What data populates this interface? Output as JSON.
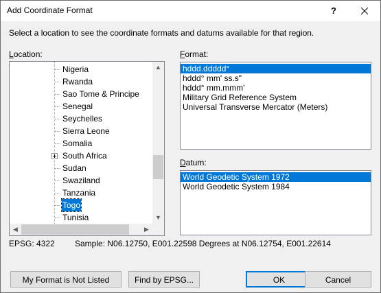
{
  "window": {
    "title": "Add Coordinate Format",
    "help_glyph": "?"
  },
  "instructions": "Select a location to see the coordinate formats and datums available for that region.",
  "location": {
    "label_accel": "L",
    "label_rest": "ocation:",
    "items": [
      {
        "label": "Nigeria"
      },
      {
        "label": "Rwanda"
      },
      {
        "label": "Sao Tome & Principe"
      },
      {
        "label": "Senegal"
      },
      {
        "label": "Seychelles"
      },
      {
        "label": "Sierra Leone"
      },
      {
        "label": "Somalia"
      },
      {
        "label": "South Africa",
        "expandable": true
      },
      {
        "label": "Sudan"
      },
      {
        "label": "Swaziland"
      },
      {
        "label": "Tanzania"
      },
      {
        "label": "Togo",
        "selected": true
      },
      {
        "label": "Tunisia"
      }
    ]
  },
  "format": {
    "label_accel": "F",
    "label_rest": "ormat:",
    "items": [
      {
        "label": "hddd.ddddd°",
        "selected": true
      },
      {
        "label": "hddd° mm' ss.s\""
      },
      {
        "label": "hddd° mm.mmm'"
      },
      {
        "label": "Military Grid Reference System"
      },
      {
        "label": "Universal Transverse Mercator (Meters)"
      }
    ]
  },
  "datum": {
    "label_accel": "D",
    "label_rest": "atum:",
    "items": [
      {
        "label": "World Geodetic System 1972",
        "selected": true
      },
      {
        "label": "World Geodetic System 1984"
      }
    ]
  },
  "epsg": "EPSG: 4322",
  "sample": "Sample: N06.12750, E001.22598 Degrees at N06.12754, E001.22614",
  "buttons": {
    "not_listed": "My Format is Not Listed",
    "find_epsg": "Find by EPSG...",
    "ok": "OK",
    "cancel": "Cancel"
  },
  "colors": {
    "selection": "#0078d7",
    "dialog_bg": "#f0f0f0"
  }
}
